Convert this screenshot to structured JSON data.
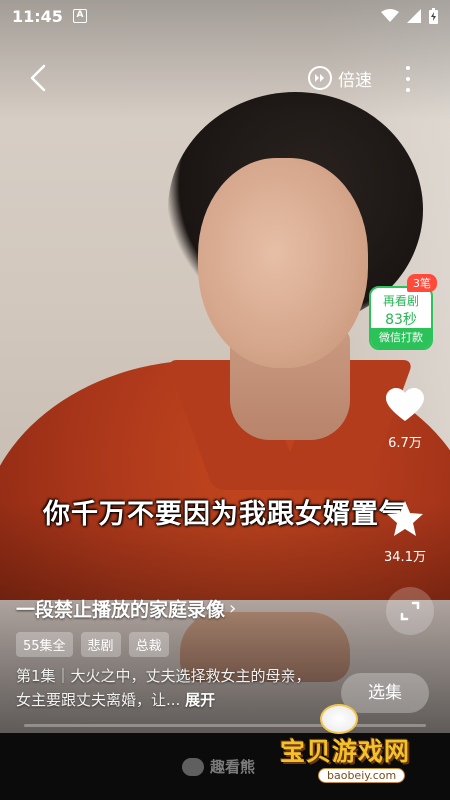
{
  "status_bar": {
    "time": "11:45",
    "notification_icon": "A"
  },
  "top_bar": {
    "speed_label": "倍速"
  },
  "reward": {
    "badge": "3笔",
    "line1": "再看剧",
    "line2": "83秒",
    "action": "微信打款"
  },
  "side": {
    "like_count": "6.7万",
    "favorite_count": "34.1万"
  },
  "subtitle": "你千万不要因为我跟女婿置气",
  "drama": {
    "title": "一段禁止播放的家庭录像",
    "tags": [
      "55集全",
      "悲剧",
      "总裁"
    ],
    "description": "第1集｜大火之中，丈夫选择救女主的母亲，女主要跟丈夫离婚，让...",
    "expand_label": "展开",
    "select_episode_label": "选集",
    "progress": 0
  },
  "footer": {
    "brand": "趣看熊"
  },
  "watermark": {
    "text": "宝贝游戏网",
    "url": "baobeiy.com"
  },
  "colors": {
    "reward_green": "#2bc25a",
    "badge_red": "#ff4a3a",
    "watermark_gold": "#f5c12a"
  }
}
